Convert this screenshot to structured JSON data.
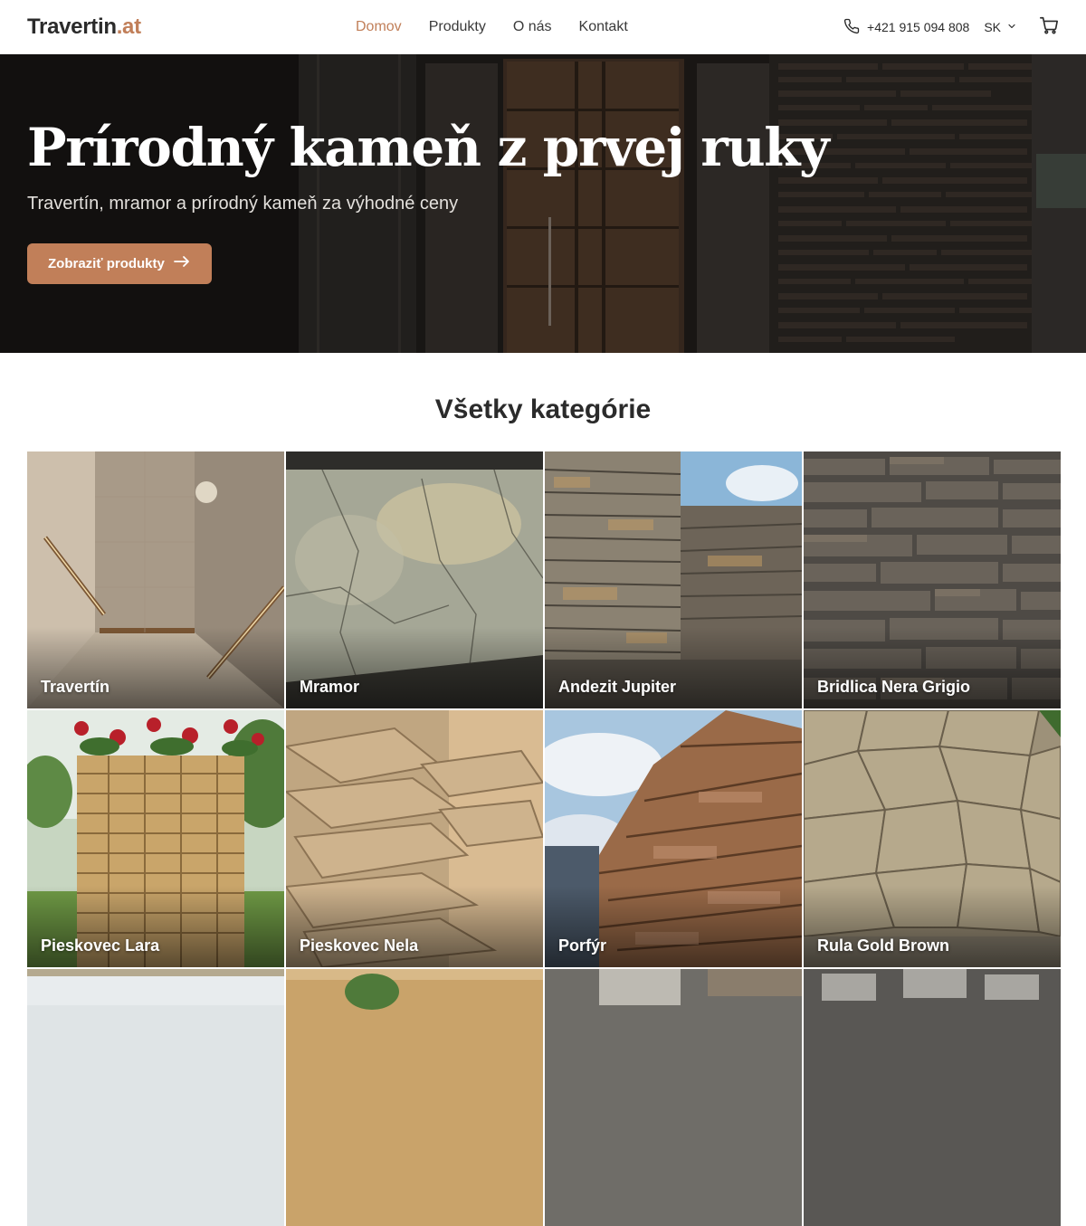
{
  "header": {
    "logo_main": "Travertin",
    "logo_tld": ".at",
    "nav": [
      {
        "label": "Domov",
        "active": true
      },
      {
        "label": "Produkty",
        "active": false
      },
      {
        "label": "O nás",
        "active": false
      },
      {
        "label": "Kontakt",
        "active": false
      }
    ],
    "phone": "+421 915 094 808",
    "phone_icon": "phone-icon",
    "language": "SK",
    "cart_icon": "cart-icon"
  },
  "hero": {
    "title": "Prírodný kameň z prvej ruky",
    "subtitle": "Travertín, mramor a prírodný kameň za výhodné ceny",
    "cta_label": "Zobraziť produkty"
  },
  "categories": {
    "title": "Všetky kategórie",
    "items": [
      {
        "label": "Travertín"
      },
      {
        "label": "Mramor"
      },
      {
        "label": "Andezit Jupiter"
      },
      {
        "label": "Bridlica Nera Grigio"
      },
      {
        "label": "Pieskovec Lara"
      },
      {
        "label": "Pieskovec Nela"
      },
      {
        "label": "Porfýr"
      },
      {
        "label": "Rula Gold Brown"
      }
    ]
  },
  "colors": {
    "accent": "#c17f59",
    "text": "#2b2b2b"
  }
}
